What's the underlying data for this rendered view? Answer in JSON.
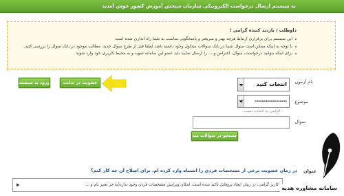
{
  "header": {
    "title": "به سیستم ارسال درخواست الکترونیکی سازمان سنجش آموزش کشور خوش آمدید"
  },
  "notice": {
    "title": "داوطلب / بازدید کننده گرامی !",
    "items": [
      "این سیستم برای برقراری ارتباط هرچه بهتر و سریعتر و پاسخگویی مناسب به شما راه اندازی شده است",
      "با توجه به اینکه ممکن است سوال شما در بانک سوالات متداول وجود داشته باشد لطفا قبل از طرح سوال جدید، مطالب موجود در بانک سوال را بررسی کنید.",
      "برای اینکه بتوانید درخواست، سوال، اعتراض و ... را ارسال نمایید باید عضو این سامانه شوید و به محیط کاربری خود وارد شوید"
    ]
  },
  "auth": {
    "login_label": "ورود به سیستم",
    "register_label": "عضویت در سایت"
  },
  "form": {
    "exam_label": "نام آزمون",
    "exam_value": "انتخاب کنید",
    "subject_label": "موضوع",
    "subject_value": "------------------",
    "subject_hint": "- الزامی به انتخاب نیست.",
    "question_label": "سوال",
    "search_label": "جستجو در سوالات متداول"
  },
  "results": {
    "title_header": "عنوان",
    "items": [
      {
        "question": "در زمان عضویت برخی از مشخصات فردی را اشتباه وارد کرده ام، برای اصلاح آن چه کار کنم؟",
        "answer": "کاربر گرامی، در زمان ایجاد پروفایل تاکید شده است، امکان ویرایش مشخصات فردی وجود ندارد(به جز تغییر نام و ..."
      }
    ]
  },
  "watermark": {
    "text": "سامانه مشاوره هدیه"
  },
  "colors": {
    "header_green": "#5a9c2a",
    "button_green": "#6aac36",
    "notice_border": "#f0ad3c",
    "notice_bg": "#fffbe8",
    "link_blue": "#1d4f9e",
    "arrow_yellow": "#f7e21a"
  },
  "icons": {
    "callout_arrow": "arrow-left-icon",
    "select_arrow": "chevron-down-icon",
    "answer_toggle": "caret-right-icon",
    "logo": "pen-nib-icon"
  }
}
